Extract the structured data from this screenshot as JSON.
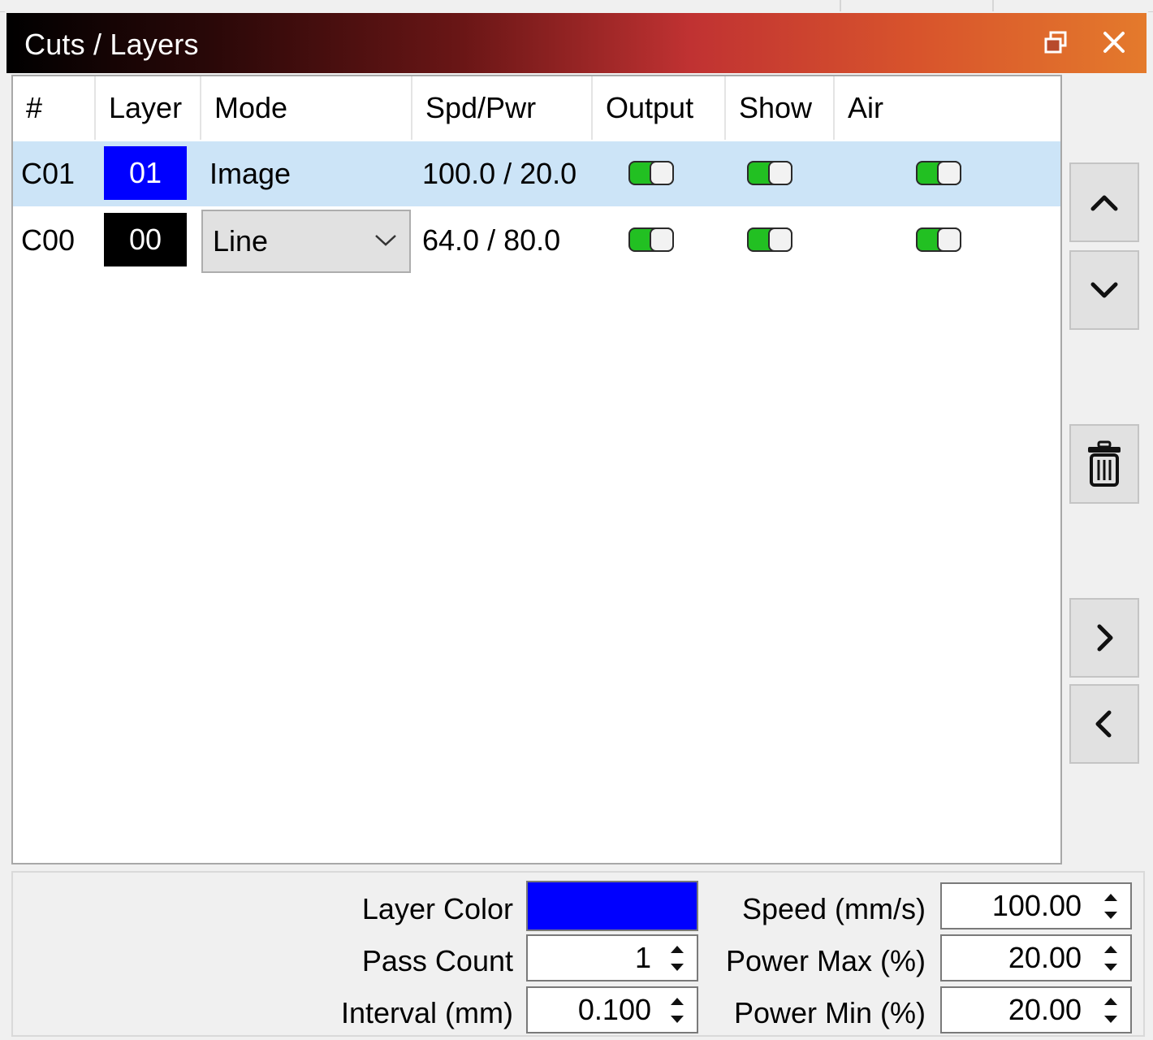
{
  "window": {
    "title": "Cuts / Layers",
    "icons": {
      "restore": "restore-icon",
      "close": "close-icon"
    }
  },
  "table": {
    "columns": [
      "#",
      "Layer",
      "Mode",
      "Spd/Pwr",
      "Output",
      "Show",
      "Air"
    ],
    "rows": [
      {
        "id": "C01",
        "layer": "01",
        "layer_color": "#0000ff",
        "mode": "Image",
        "speed_power": "100.0 / 20.0",
        "output": true,
        "show": true,
        "air": true,
        "selected": true
      },
      {
        "id": "C00",
        "layer": "00",
        "layer_color": "#000000",
        "mode": "Line",
        "speed_power": "64.0 / 80.0",
        "output": true,
        "show": true,
        "air": true,
        "selected": false
      }
    ]
  },
  "side_buttons": [
    "move-up-icon",
    "move-down-icon",
    "delete-icon",
    "chevron-right-icon",
    "chevron-left-icon"
  ],
  "properties": {
    "layer_color_label": "Layer Color",
    "layer_color": "#0000ff",
    "pass_count_label": "Pass Count",
    "pass_count": "1",
    "interval_label": "Interval (mm)",
    "interval": "0.100",
    "speed_label": "Speed (mm/s)",
    "speed": "100.00",
    "power_max_label": "Power Max (%)",
    "power_max": "20.00",
    "power_min_label": "Power Min (%)",
    "power_min": "20.00"
  },
  "colors": {
    "toggle_on": "#22c022",
    "selected_row": "#cce4f7"
  }
}
